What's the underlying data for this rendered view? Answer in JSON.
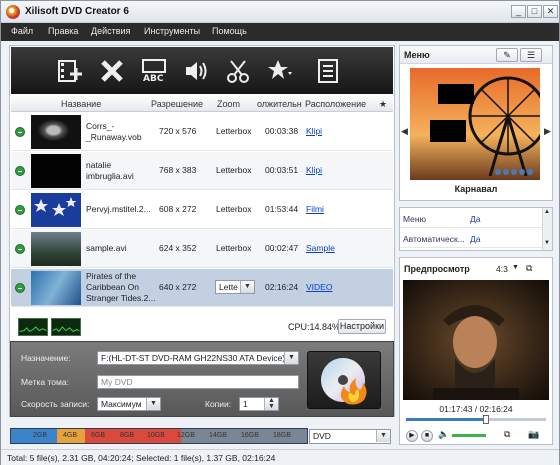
{
  "window": {
    "title": "Xilisoft DVD Creator 6",
    "min": "_",
    "max": "□",
    "close": "✕"
  },
  "menu": [
    "Файл",
    "Правка",
    "Действия",
    "Инструменты",
    "Помощь"
  ],
  "table": {
    "headers": [
      "Название",
      "Разрешение",
      "Zoom",
      "олжительн",
      "Расположение",
      "★"
    ],
    "rows": [
      {
        "name": "Corrs_-\n_Runaway.vob",
        "resolution": "720 x 576",
        "zoom": "Letterbox",
        "duration": "00:03:38",
        "location": "Klipi"
      },
      {
        "name": "natalie\nimbruglia.avi",
        "resolution": "768 x 383",
        "zoom": "Letterbox",
        "duration": "00:03:51",
        "location": "Klipi"
      },
      {
        "name": "Pervyj.mstitel.2...",
        "resolution": "608 x 272",
        "zoom": "Letterbox",
        "duration": "01:53:44",
        "location": "Filmi"
      },
      {
        "name": "sample.avi",
        "resolution": "624 x 352",
        "zoom": "Letterbox",
        "duration": "00:02:47",
        "location": "Sample"
      },
      {
        "name": "Pirates of the\nCaribbean On\nStranger Tides.2...",
        "resolution": "640 x 272",
        "zoom": "Lette",
        "duration": "02:16:24",
        "location": "VIDEO"
      }
    ]
  },
  "cpu": {
    "label": "CPU:14.84%",
    "settings_button": "Настройки"
  },
  "bottom": {
    "dest_label": "Назначение:",
    "dest_value": "F:(HL-DT-ST DVD-RAM GH22NS30 ATA Device)",
    "volume_label": "Метка тома:",
    "volume_value": "My DVD",
    "speed_label": "Скорость записи:",
    "speed_value": "Максимум",
    "copies_label": "Копии:",
    "copies_value": "1"
  },
  "capacity": {
    "ticks": [
      "2GB",
      "4GB",
      "6GB",
      "8GB",
      "10GB",
      "12GB",
      "14GB",
      "16GB",
      "18GB"
    ],
    "used_fraction": 0.3,
    "disc_type": "DVD"
  },
  "status": "Total: 5 file(s), 2.31 GB,  04:20:24; Selected: 1 file(s), 1.37 GB,  02:16:24",
  "menu_panel": {
    "title": "Меню",
    "caption": "Карнавал"
  },
  "properties": [
    {
      "key": "Меню",
      "value": "Да"
    },
    {
      "key": "Автоматическ...",
      "value": "Да"
    }
  ],
  "preview": {
    "title": "Предпросмотр",
    "aspect": "4:3",
    "time": "01:17:43 / 02:16:24",
    "position_fraction": 0.57
  },
  "colors": {
    "toolbar": "#1e1e1e",
    "link": "#0b40c9",
    "menubar": "#2b2b2b"
  },
  "icons": [
    "add-file-icon",
    "delete-icon",
    "subtitle-icon",
    "audio-icon",
    "clip-icon",
    "effect-icon",
    "menu-list-icon"
  ]
}
